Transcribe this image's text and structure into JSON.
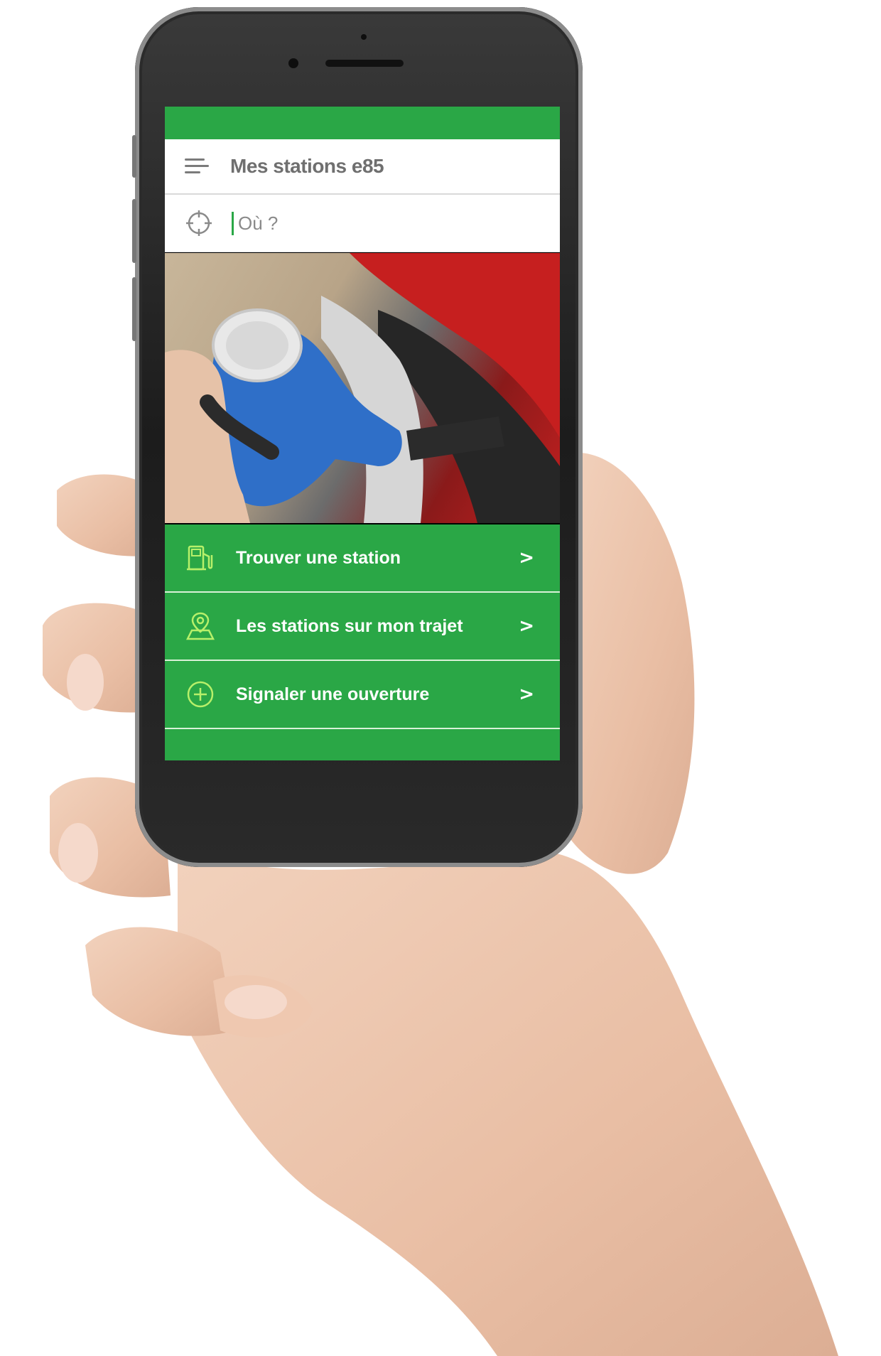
{
  "app": {
    "title": "Mes stations e85",
    "accent_color": "#2aa746",
    "icon_color": "#b7f06a"
  },
  "search": {
    "placeholder": "Où ?",
    "value": ""
  },
  "menu": {
    "items": [
      {
        "label": "Trouver une station",
        "icon": "fuel-pump-icon",
        "chevron": ">"
      },
      {
        "label": "Les stations sur mon trajet",
        "icon": "map-pin-icon",
        "chevron": ">"
      },
      {
        "label": "Signaler une ouverture",
        "icon": "plus-circle-icon",
        "chevron": ">"
      }
    ]
  },
  "hero": {
    "description_icon": "fuel-nozzle-image"
  }
}
